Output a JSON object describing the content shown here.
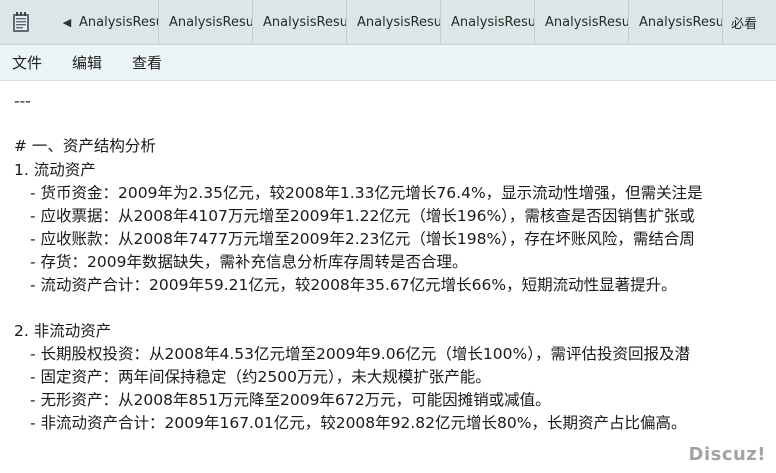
{
  "tabs": [
    "AnalysisResu",
    "AnalysisResu",
    "AnalysisResu",
    "AnalysisResu",
    "AnalysisResu",
    "AnalysisResu",
    "AnalysisResu",
    "必看"
  ],
  "menu": [
    "文件",
    "编辑",
    "查看"
  ],
  "content": {
    "separator": "---",
    "heading": "# 一、资产结构分析",
    "section1": {
      "title": "1. 流动资产",
      "items": [
        "- 货币资金：2009年为2.35亿元，较2008年1.33亿元增长76.4%，显示流动性增强，但需关注是",
        "- 应收票据：从2008年4107万元增至2009年1.22亿元（增长196%），需核查是否因销售扩张或",
        "- 应收账款：从2008年7477万元增至2009年2.23亿元（增长198%），存在坏账风险，需结合周",
        "- 存货：2009年数据缺失，需补充信息分析库存周转是否合理。",
        "- 流动资产合计：2009年59.21亿元，较2008年35.67亿元增长66%，短期流动性显著提升。"
      ]
    },
    "section2": {
      "title": "2. 非流动资产",
      "items": [
        "- 长期股权投资：从2008年4.53亿元增至2009年9.06亿元（增长100%），需评估投资回报及潜",
        "- 固定资产：两年间保持稳定（约2500万元），未大规模扩张产能。",
        "- 无形资产：从2008年851万元降至2009年672万元，可能因摊销或减值。",
        "- 非流动资产合计：2009年167.01亿元，较2008年92.82亿元增长80%，长期资产占比偏高。"
      ]
    }
  },
  "watermark": "Discuz!"
}
